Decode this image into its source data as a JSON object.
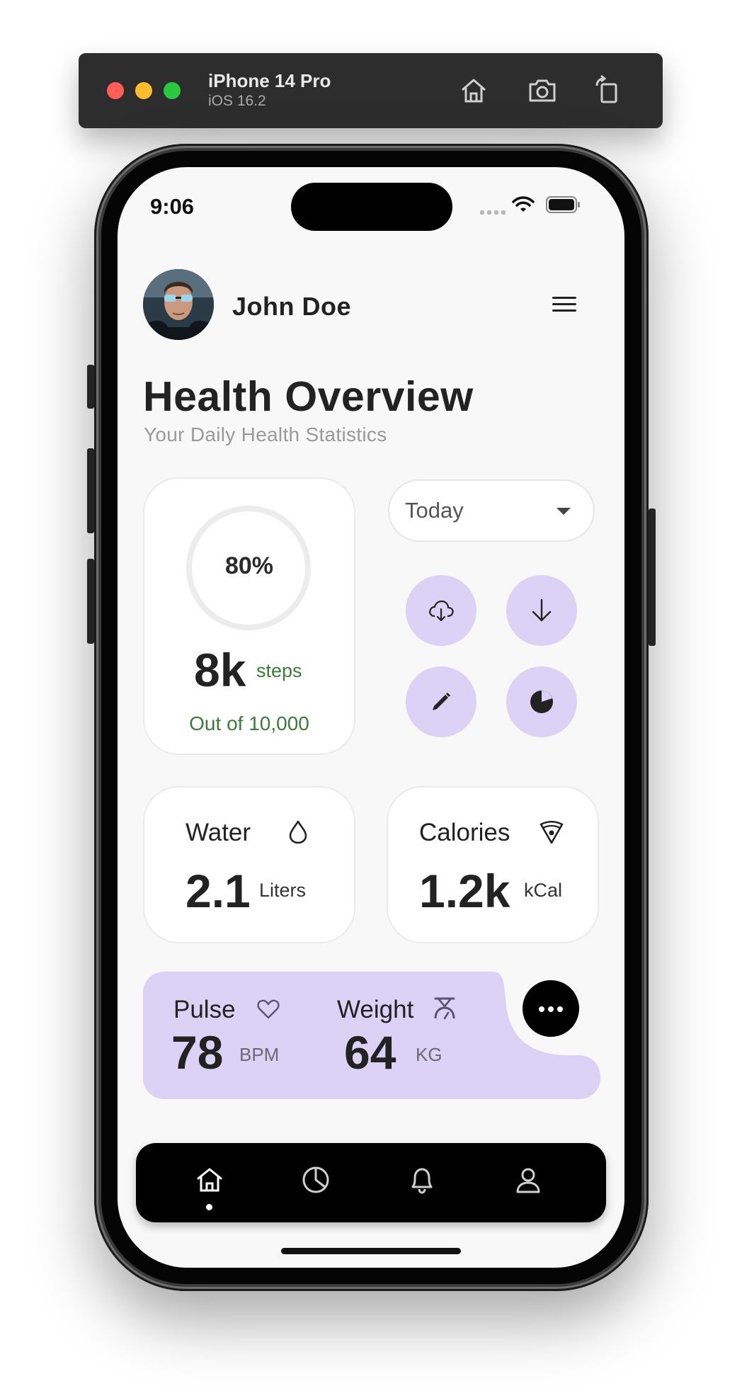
{
  "simulator": {
    "device_name": "iPhone 14 Pro",
    "os_version": "iOS 16.2",
    "toolbar_icons": [
      "home-icon",
      "screenshot-icon",
      "rotate-icon"
    ]
  },
  "status_bar": {
    "time": "9:06",
    "icons": [
      "cellular-icon",
      "wifi-icon",
      "battery-icon"
    ]
  },
  "header": {
    "user_name": "John Doe",
    "menu_icon": "hamburger-menu-icon"
  },
  "page": {
    "title": "Health Overview",
    "subtitle": "Your Daily Health Statistics"
  },
  "steps": {
    "progress_text": "80%",
    "progress_fraction": 0.8,
    "value": "8k",
    "unit": "steps",
    "goal_text": "Out of 10,000"
  },
  "period_select": {
    "selected": "Today"
  },
  "quick_actions": [
    {
      "icon": "cloud-download-icon"
    },
    {
      "icon": "arrow-down-icon"
    },
    {
      "icon": "pencil-icon"
    },
    {
      "icon": "pie-chart-icon"
    }
  ],
  "water": {
    "label": "Water",
    "value": "2.1",
    "unit": "Liters",
    "icon": "water-drop-icon"
  },
  "calories": {
    "label": "Calories",
    "value": "1.2k",
    "unit": "kCal",
    "icon": "pizza-slice-icon"
  },
  "pulse": {
    "label": "Pulse",
    "value": "78",
    "unit": "BPM",
    "icon": "heart-icon"
  },
  "weight": {
    "label": "Weight",
    "value": "64",
    "unit": "KG",
    "icon": "scale-icon"
  },
  "more_button": {
    "icon": "more-horizontal-icon"
  },
  "bottom_nav": {
    "items": [
      "home-icon",
      "pie-chart-icon",
      "bell-icon",
      "user-icon"
    ],
    "active": "home-icon"
  },
  "colors": {
    "accent_lilac": "#dcd2f5",
    "steps_green": "#3e7a3c",
    "nav_background": "#000000",
    "screen_background": "#f8f8f8"
  }
}
